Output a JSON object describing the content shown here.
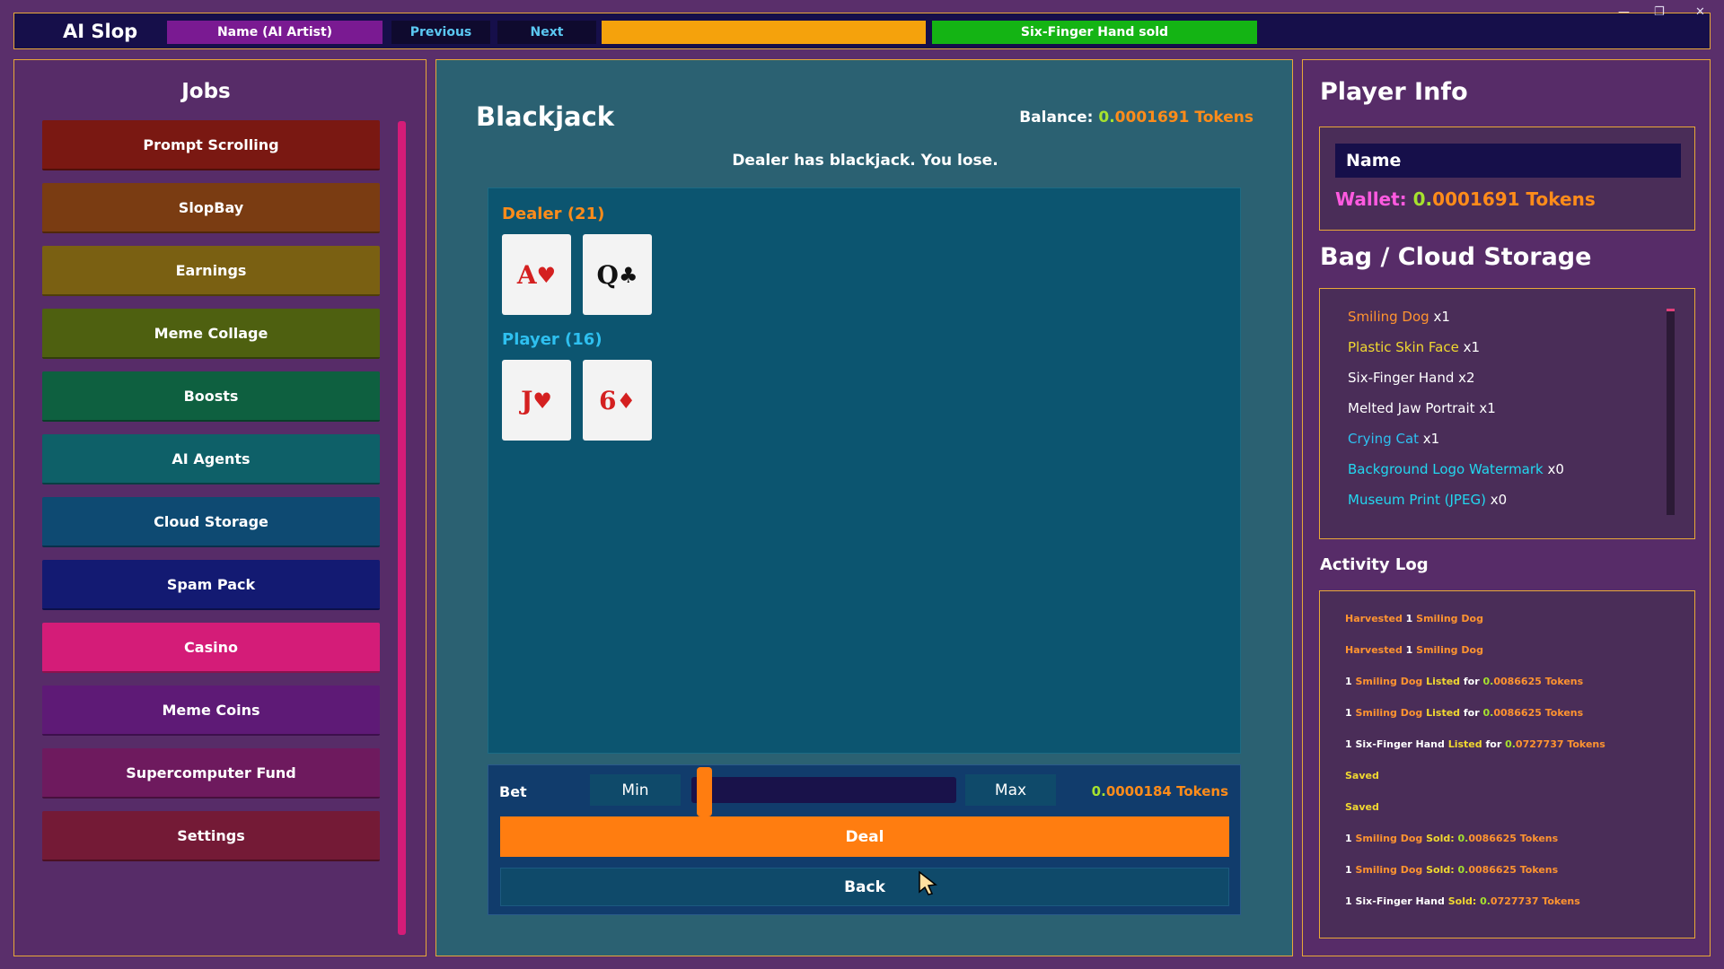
{
  "app": {
    "title": "AI Slop"
  },
  "topbar": {
    "name_label": "Name (AI Artist)",
    "previous_label": "Previous",
    "next_label": "Next",
    "notice": "Six-Finger Hand sold",
    "window_controls": [
      "—",
      "❐",
      "✕"
    ]
  },
  "jobs": {
    "heading": "Jobs",
    "items": [
      {
        "label": "Prompt Scrolling",
        "color": "#7a1812"
      },
      {
        "label": "SlopBay",
        "color": "#7a3c12"
      },
      {
        "label": "Earnings",
        "color": "#7a6012"
      },
      {
        "label": "Meme Collage",
        "color": "#4e6010"
      },
      {
        "label": "Boosts",
        "color": "#0e6040"
      },
      {
        "label": "AI Agents",
        "color": "#0e6068"
      },
      {
        "label": "Cloud Storage",
        "color": "#0e4a72"
      },
      {
        "label": "Spam Pack",
        "color": "#131a72"
      },
      {
        "label": "Casino",
        "color": "#d41c78"
      },
      {
        "label": "Meme Coins",
        "color": "#5e1a76"
      },
      {
        "label": "Supercomputer Fund",
        "color": "#6e1a5e"
      },
      {
        "label": "Settings",
        "color": "#741a36"
      }
    ],
    "active": "Casino"
  },
  "game": {
    "title": "Blackjack",
    "balance_label": "Balance: ",
    "balance_value_a": "0.",
    "balance_value_b": "0001691 Tokens",
    "result": "Dealer has blackjack. You lose.",
    "dealer_label": "Dealer  (21)",
    "player_label": "Player  (16)",
    "dealer_cards": [
      {
        "rank": "A",
        "suit": "♥",
        "color": "red"
      },
      {
        "rank": "Q",
        "suit": "♣",
        "color": "black"
      }
    ],
    "player_cards": [
      {
        "rank": "J",
        "suit": "♥",
        "color": "red"
      },
      {
        "rank": "6",
        "suit": "♦",
        "color": "red"
      }
    ],
    "bet": {
      "label": "Bet",
      "min_label": "Min",
      "max_label": "Max",
      "slider_position": 0.0,
      "amount_a": "0.",
      "amount_b": "0000184 Tokens"
    },
    "deal_label": "Deal",
    "back_label": "Back"
  },
  "player_info": {
    "heading": "Player Info",
    "name": "Name",
    "wallet_label": "Wallet: ",
    "wallet_value_a": "0.",
    "wallet_value_b": "0001691 Tokens"
  },
  "bag": {
    "heading": "Bag / Cloud Storage",
    "items": [
      {
        "name": "Smiling Dog",
        "qty": " x1",
        "color": "#ff9430"
      },
      {
        "name": "Plastic Skin Face",
        "qty": " x1",
        "color": "#f0d830"
      },
      {
        "name": "Six-Finger Hand",
        "qty": " x2",
        "color": "#ffffff"
      },
      {
        "name": "Melted Jaw Portrait",
        "qty": " x1",
        "color": "#ffffff"
      },
      {
        "name": "Crying Cat",
        "qty": " x1",
        "color": "#2ec0f0"
      },
      {
        "name": "Background Logo Watermark",
        "qty": " x0",
        "color": "#22d8f0"
      },
      {
        "name": "Museum Print (JPEG)",
        "qty": " x0",
        "color": "#22d8f0"
      }
    ]
  },
  "activity": {
    "heading": "Activity Log",
    "lines": [
      [
        {
          "t": "Harvested",
          "c": "lo"
        },
        {
          "t": " 1 ",
          "c": ""
        },
        {
          "t": "Smiling Dog",
          "c": "lo"
        }
      ],
      [
        {
          "t": "Harvested",
          "c": "lo"
        },
        {
          "t": " 1 ",
          "c": ""
        },
        {
          "t": "Smiling Dog",
          "c": "lo"
        }
      ],
      [
        {
          "t": "1 ",
          "c": ""
        },
        {
          "t": "Smiling Dog",
          "c": "lo"
        },
        {
          "t": " Listed",
          "c": "ly"
        },
        {
          "t": " for ",
          "c": ""
        },
        {
          "t": "0.",
          "c": "lg"
        },
        {
          "t": "0086625 Tokens",
          "c": "lo"
        }
      ],
      [
        {
          "t": "1 ",
          "c": ""
        },
        {
          "t": "Smiling Dog",
          "c": "lo"
        },
        {
          "t": " Listed",
          "c": "ly"
        },
        {
          "t": " for ",
          "c": ""
        },
        {
          "t": "0.",
          "c": "lg"
        },
        {
          "t": "0086625 Tokens",
          "c": "lo"
        }
      ],
      [
        {
          "t": "1 Six-Finger Hand",
          "c": ""
        },
        {
          "t": " Listed",
          "c": "ly"
        },
        {
          "t": " for ",
          "c": ""
        },
        {
          "t": "0.",
          "c": "lg"
        },
        {
          "t": "0727737 Tokens",
          "c": "lo"
        }
      ],
      [
        {
          "t": "Saved",
          "c": "ly"
        }
      ],
      [
        {
          "t": "Saved",
          "c": "ly"
        }
      ],
      [
        {
          "t": "1 ",
          "c": ""
        },
        {
          "t": "Smiling Dog",
          "c": "lo"
        },
        {
          "t": " Sold: ",
          "c": "ly"
        },
        {
          "t": "0.",
          "c": "lg"
        },
        {
          "t": "0086625 Tokens",
          "c": "lo"
        }
      ],
      [
        {
          "t": "1 ",
          "c": ""
        },
        {
          "t": "Smiling Dog",
          "c": "lo"
        },
        {
          "t": " Sold: ",
          "c": "ly"
        },
        {
          "t": "0.",
          "c": "lg"
        },
        {
          "t": "0086625 Tokens",
          "c": "lo"
        }
      ],
      [
        {
          "t": "1 Six-Finger Hand",
          "c": ""
        },
        {
          "t": " Sold: ",
          "c": "ly"
        },
        {
          "t": "0.",
          "c": "lg"
        },
        {
          "t": "0727737 Tokens",
          "c": "lo"
        }
      ]
    ]
  }
}
